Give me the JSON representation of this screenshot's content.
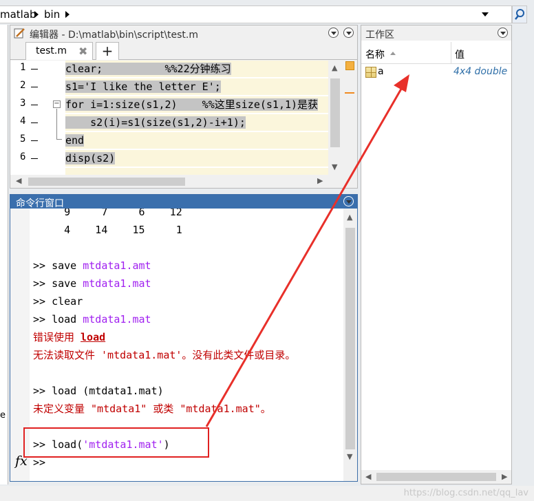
{
  "address": {
    "crumbs": [
      "matlab",
      "bin"
    ]
  },
  "editor": {
    "title": "编辑器 - D:\\matlab\\bin\\script\\test.m",
    "tab_label": "test.m",
    "tab_close": "✖",
    "tab_add": "+",
    "lines": [
      {
        "n": "1",
        "text": "clear;          %%22分钟练习"
      },
      {
        "n": "2",
        "text": "s1='I like the letter E';"
      },
      {
        "n": "3",
        "text": "for i=1:size(s1,2)    %%这里size(s1,1)是获"
      },
      {
        "n": "4",
        "text": "    s2(i)=s1(size(s1,2)-i+1);"
      },
      {
        "n": "5",
        "text": "end"
      },
      {
        "n": "6",
        "text": "disp(s2)"
      }
    ]
  },
  "command_window": {
    "title": "命令行窗口",
    "matrix_rows": [
      "     9     7     6    12",
      "     4    14    15     1"
    ],
    "prompt": ">>",
    "cmd1_prefix": " save ",
    "cmd1_arg": "mtdata1.amt",
    "cmd2_prefix": " save ",
    "cmd2_arg": "mtdata1.mat",
    "cmd3_prefix": " clear",
    "cmd4_prefix": " load ",
    "cmd4_arg": "mtdata1.mat",
    "err1_prefix": "错误使用 ",
    "err1_func": "load",
    "err1_msg": "无法读取文件 'mtdata1.mat'。没有此类文件或目录。",
    "cmd5_text": " load (mtdata1.mat)",
    "err2_msg": "未定义变量 \"mtdata1\" 或类 \"mtdata1.mat\"。",
    "cmd6_prefix": " load(",
    "cmd6_arg": "'mtdata1.mat'",
    "cmd6_suffix": ")",
    "fx_label": "fx"
  },
  "workspace": {
    "title": "工作区",
    "col_name": "名称",
    "col_value": "值",
    "rows": [
      {
        "name": "a",
        "value": "4x4 double"
      }
    ]
  },
  "left_trunc": "e",
  "watermark": "https://blog.csdn.net/qq_lav"
}
